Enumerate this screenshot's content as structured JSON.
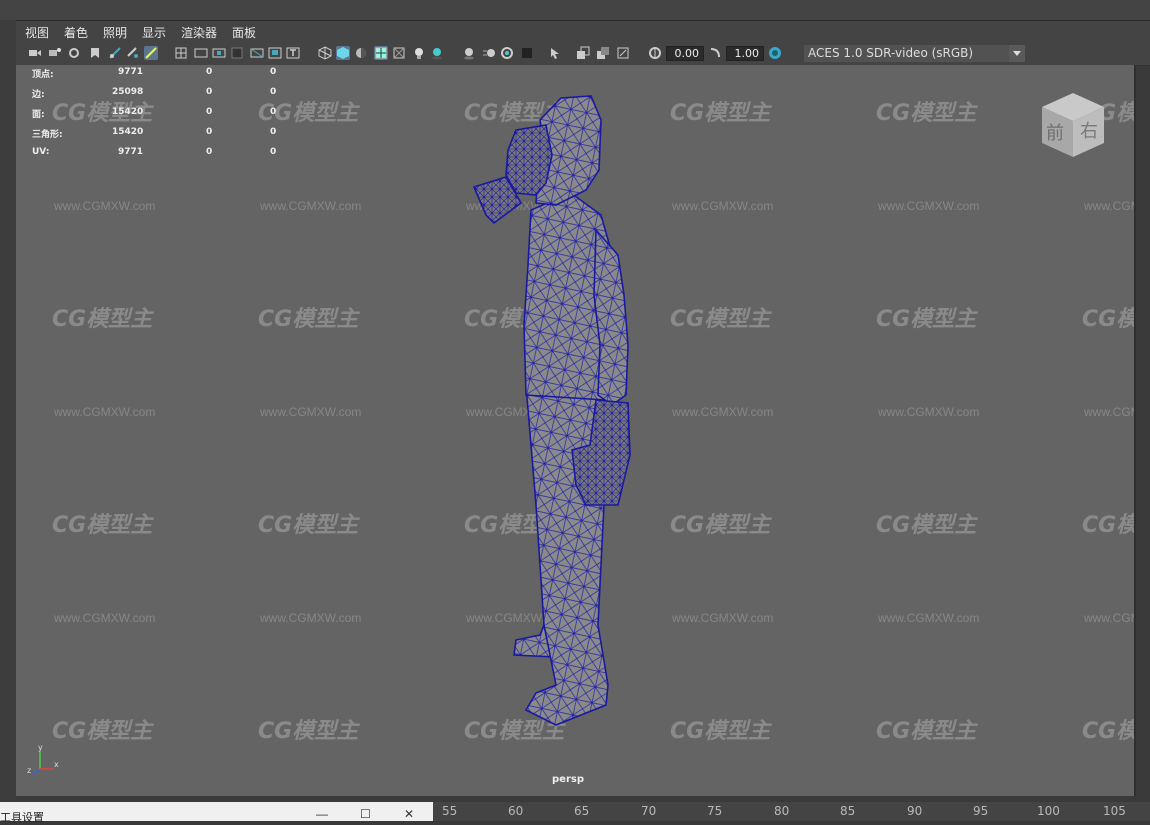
{
  "menu": [
    "视图",
    "着色",
    "照明",
    "显示",
    "渲染器",
    "面板"
  ],
  "toolbar": {
    "exposure": "0.00",
    "gamma": "1.00",
    "color_space": "ACES 1.0 SDR-video (sRGB)"
  },
  "hud": {
    "rows": [
      {
        "label": "顶点:",
        "v1": "9771",
        "v2": "0",
        "v3": "0"
      },
      {
        "label": "边:",
        "v1": "25098",
        "v2": "0",
        "v3": "0"
      },
      {
        "label": "面:",
        "v1": "15420",
        "v2": "0",
        "v3": "0"
      },
      {
        "label": "三角形:",
        "v1": "15420",
        "v2": "0",
        "v3": "0"
      },
      {
        "label": "UV:",
        "v1": "9771",
        "v2": "0",
        "v3": "0"
      }
    ]
  },
  "viewcube": {
    "front": "前",
    "right": "右"
  },
  "watermark": {
    "logo": "CG模型主",
    "url": "www.CGMXW.com"
  },
  "viewport_label": "persp",
  "axis": {
    "x": "x",
    "y": "y",
    "z": "z"
  },
  "tool_settings_title": "工具设置",
  "timeline_ticks": [
    "55",
    "60",
    "65",
    "70",
    "75",
    "80",
    "85",
    "90",
    "95",
    "100",
    "105"
  ],
  "colors": {
    "wireframe": "#1a1aa0",
    "viewport_bg": "#646464",
    "ui_bg": "#444444"
  }
}
